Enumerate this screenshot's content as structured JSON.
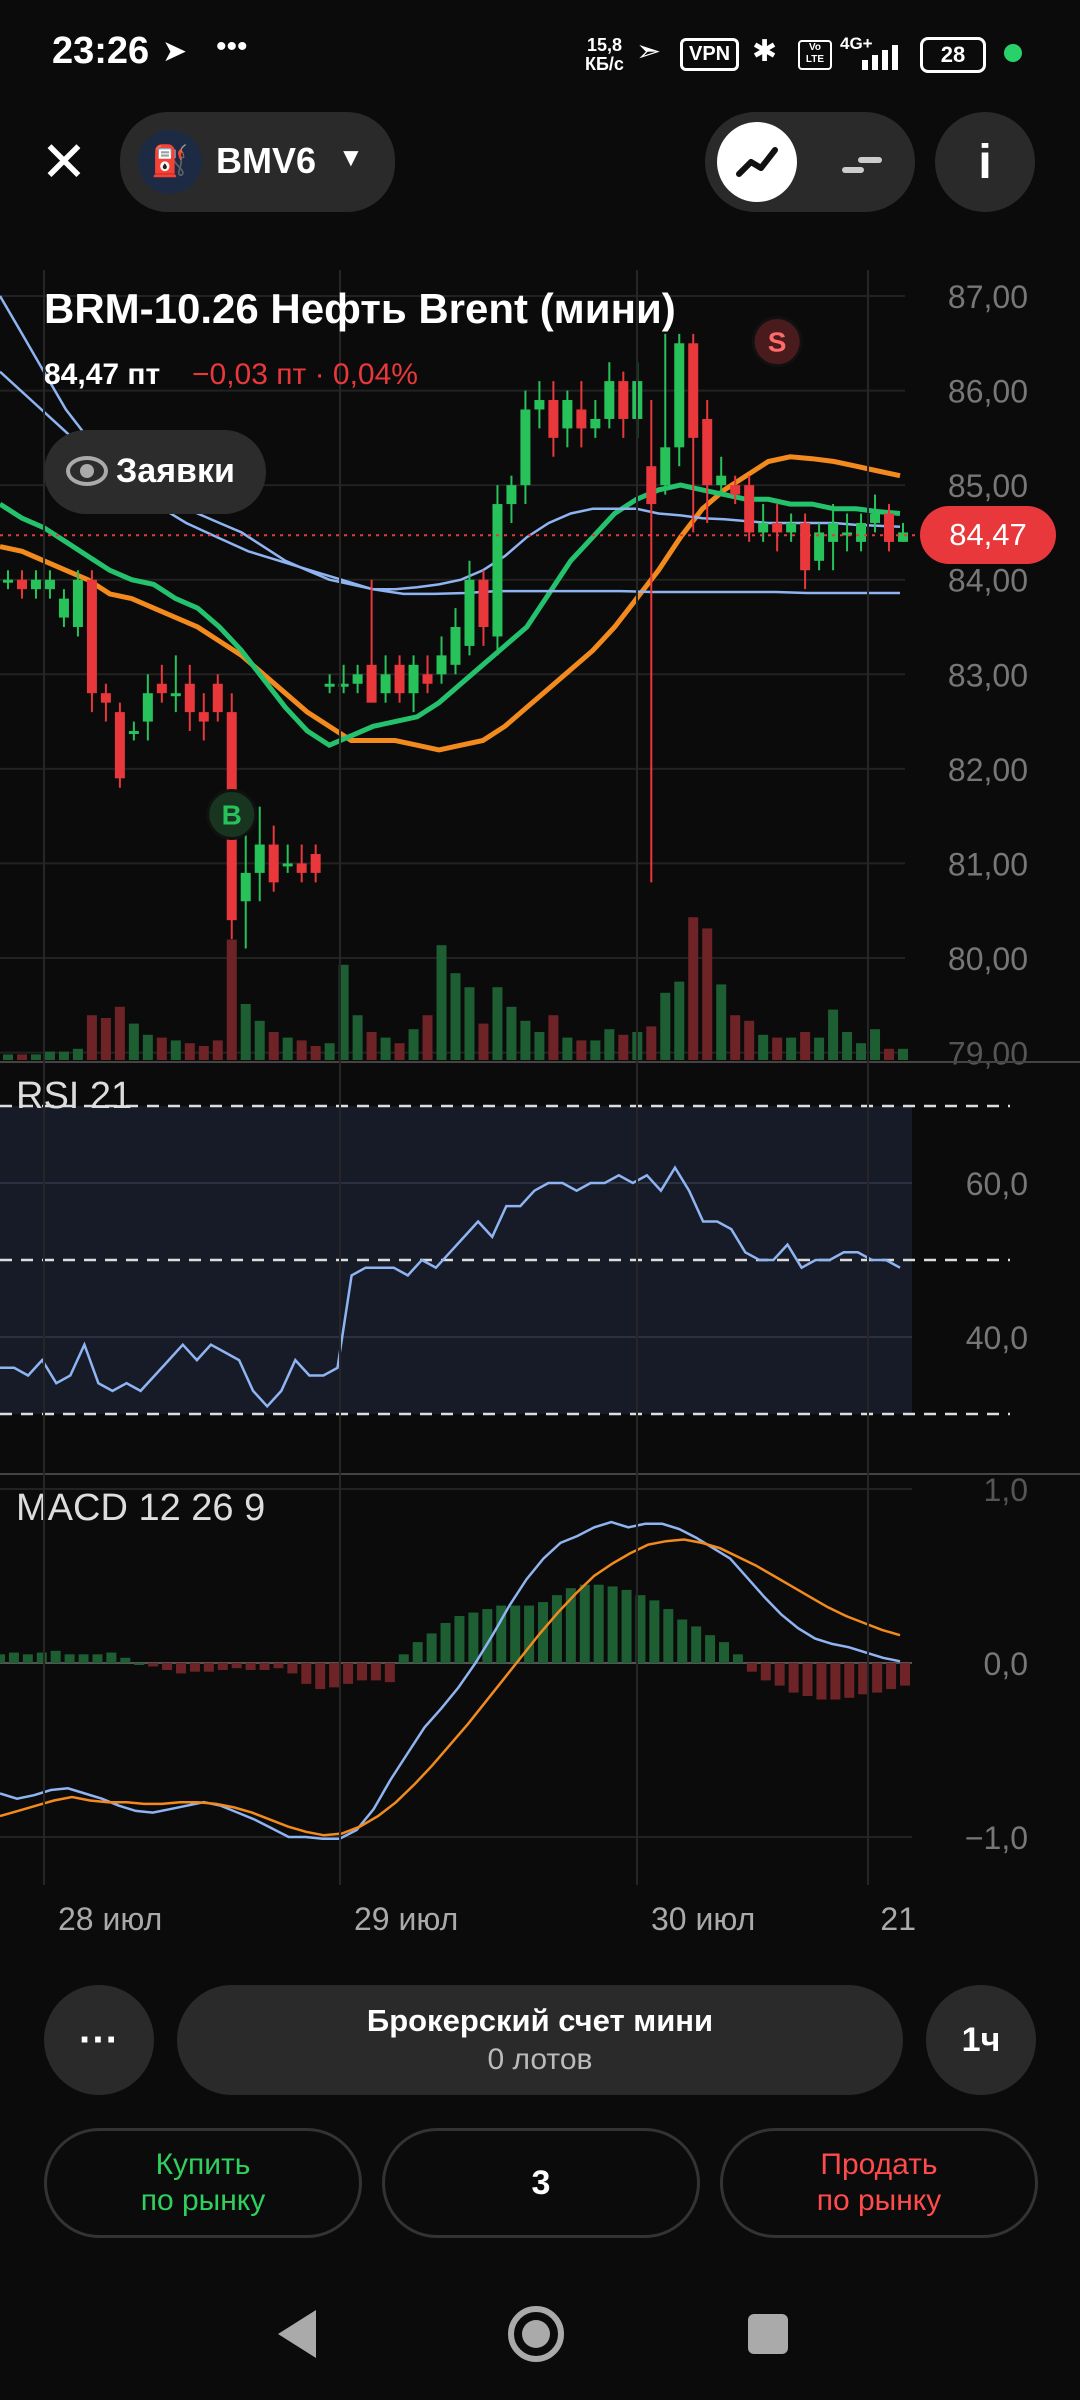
{
  "status_bar": {
    "time": "23:26",
    "net_speed_value": "15,8",
    "net_speed_unit": "КБ/с",
    "vpn": "VPN",
    "network": "4G+",
    "battery": "28",
    "icons": [
      "telegram-icon",
      "more-icon",
      "location-icon",
      "bluetooth-icon",
      "volte-icon",
      "signal-icon"
    ]
  },
  "header": {
    "ticker": "BMV6",
    "instrument_title": "BRM-10.26 Нефть Brent (мини)",
    "price": "84,47 пт",
    "change": "−0,03 пт · 0,04%",
    "orders_label": "Заявки",
    "current_price_tag": "84,47"
  },
  "colors": {
    "up": "#27c25a",
    "down": "#e8383b",
    "ma_orange": "#f28a1e",
    "ma_green": "#25c26e",
    "ma_blue": "#8fb4f2",
    "accent_red_tag": "#e8383b"
  },
  "chart_data": [
    {
      "type": "candlestick",
      "title": "",
      "y_ticks": [
        "87,00",
        "86,00",
        "85,00",
        "84,00",
        "83,00",
        "82,00",
        "81,00",
        "80,00",
        "79,00"
      ],
      "ylim": [
        79,
        87.6
      ],
      "x_ticks": [
        "28 июл",
        "29 июл",
        "30 июл",
        "21"
      ],
      "last_price": 84.47,
      "markers": [
        {
          "label": "B",
          "x": 16,
          "price": 81.2
        },
        {
          "label": "S",
          "x": 55,
          "price": 86.2
        }
      ],
      "candles": [
        [
          84.0,
          84.0,
          83.9,
          84.1
        ],
        [
          84.0,
          83.9,
          83.8,
          84.1
        ],
        [
          83.9,
          84.0,
          83.8,
          84.1
        ],
        [
          83.9,
          84.0,
          83.8,
          84.1
        ],
        [
          83.6,
          83.8,
          83.5,
          83.9
        ],
        [
          83.5,
          84.0,
          83.4,
          84.1
        ],
        [
          84.0,
          82.8,
          82.6,
          84.1
        ],
        [
          82.8,
          82.7,
          82.5,
          82.9
        ],
        [
          82.6,
          81.9,
          81.8,
          82.7
        ],
        [
          82.4,
          82.4,
          82.3,
          82.5
        ],
        [
          82.5,
          82.8,
          82.3,
          83.0
        ],
        [
          82.9,
          82.8,
          82.7,
          83.1
        ],
        [
          82.8,
          82.8,
          82.6,
          83.2
        ],
        [
          82.9,
          82.6,
          82.4,
          83.1
        ],
        [
          82.6,
          82.5,
          82.3,
          82.8
        ],
        [
          82.9,
          82.6,
          82.5,
          83.0
        ],
        [
          82.6,
          80.4,
          80.2,
          82.8
        ],
        [
          80.6,
          80.9,
          80.1,
          81.3
        ],
        [
          80.9,
          81.2,
          80.6,
          81.6
        ],
        [
          81.2,
          80.8,
          80.7,
          81.4
        ],
        [
          81.0,
          81.0,
          80.9,
          81.2
        ],
        [
          81.0,
          80.9,
          80.8,
          81.2
        ],
        [
          81.1,
          80.9,
          80.8,
          81.2
        ],
        [
          82.9,
          82.9,
          82.8,
          83.0
        ],
        [
          82.9,
          82.9,
          82.8,
          83.1
        ],
        [
          82.9,
          83.0,
          82.8,
          83.1
        ],
        [
          83.1,
          82.7,
          82.7,
          84.0
        ],
        [
          82.8,
          83.0,
          82.7,
          83.2
        ],
        [
          83.1,
          82.8,
          82.7,
          83.2
        ],
        [
          82.8,
          83.1,
          82.6,
          83.2
        ],
        [
          83.0,
          82.9,
          82.8,
          83.2
        ],
        [
          83.0,
          83.2,
          82.9,
          83.4
        ],
        [
          83.1,
          83.5,
          83.0,
          83.7
        ],
        [
          83.3,
          84.0,
          83.2,
          84.2
        ],
        [
          84.0,
          83.5,
          83.3,
          84.1
        ],
        [
          83.4,
          84.8,
          83.2,
          85.0
        ],
        [
          84.8,
          85.0,
          84.6,
          85.1
        ],
        [
          85.0,
          85.8,
          84.8,
          86.0
        ],
        [
          85.8,
          85.9,
          85.6,
          86.1
        ],
        [
          85.9,
          85.5,
          85.3,
          86.1
        ],
        [
          85.6,
          85.9,
          85.4,
          86.0
        ],
        [
          85.8,
          85.6,
          85.4,
          86.1
        ],
        [
          85.6,
          85.7,
          85.5,
          85.9
        ],
        [
          85.7,
          86.1,
          85.6,
          86.3
        ],
        [
          86.1,
          85.7,
          85.5,
          86.2
        ],
        [
          85.7,
          86.1,
          85.5,
          86.3
        ],
        [
          85.2,
          84.8,
          80.8,
          85.9
        ],
        [
          85.0,
          85.4,
          84.9,
          86.6
        ],
        [
          85.4,
          86.5,
          85.2,
          86.6
        ],
        [
          86.5,
          85.5,
          84.5,
          86.6
        ],
        [
          85.7,
          85.0,
          84.6,
          85.9
        ],
        [
          85.0,
          85.1,
          84.9,
          85.3
        ],
        [
          85.0,
          84.9,
          84.8,
          85.1
        ],
        [
          85.0,
          84.5,
          84.4,
          85.1
        ],
        [
          84.5,
          84.6,
          84.4,
          84.8
        ],
        [
          84.6,
          84.5,
          84.3,
          84.8
        ],
        [
          84.5,
          84.6,
          84.4,
          84.7
        ],
        [
          84.6,
          84.1,
          83.9,
          84.7
        ],
        [
          84.2,
          84.5,
          84.1,
          84.6
        ],
        [
          84.4,
          84.6,
          84.1,
          84.8
        ],
        [
          84.5,
          84.5,
          84.3,
          84.7
        ],
        [
          84.4,
          84.6,
          84.3,
          84.7
        ],
        [
          84.6,
          84.7,
          84.5,
          84.9
        ],
        [
          84.7,
          84.4,
          84.3,
          84.8
        ],
        [
          84.4,
          84.5,
          84.4,
          84.6
        ]
      ],
      "volumes": [
        0.2,
        0.2,
        0.2,
        0.3,
        0.3,
        0.4,
        1.6,
        1.5,
        1.9,
        1.3,
        0.9,
        0.8,
        0.7,
        0.6,
        0.5,
        0.7,
        4.3,
        2.0,
        1.4,
        1.0,
        0.8,
        0.7,
        0.5,
        0.6,
        3.4,
        1.6,
        1.0,
        0.8,
        0.6,
        1.1,
        1.6,
        4.1,
        3.1,
        2.6,
        1.3,
        2.6,
        1.9,
        1.4,
        1.0,
        1.6,
        0.8,
        0.7,
        0.7,
        1.1,
        0.9,
        1.0,
        1.2,
        2.4,
        2.8,
        5.1,
        4.7,
        2.7,
        1.6,
        1.4,
        0.9,
        0.8,
        0.8,
        1.0,
        0.8,
        1.8,
        1.0,
        0.6,
        1.1,
        0.4,
        0.4
      ],
      "series": [
        {
          "values": [
            84.35,
            84.3,
            84.2,
            84.1,
            84.0,
            83.85,
            83.8,
            83.7,
            83.6,
            83.5,
            83.35,
            83.2,
            83.0,
            82.8,
            82.6,
            82.45,
            82.3,
            82.3,
            82.3,
            82.25,
            82.2,
            82.25,
            82.3,
            82.45,
            82.65,
            82.85,
            83.05,
            83.25,
            83.5,
            83.8,
            84.1,
            84.45,
            84.75,
            84.95,
            85.1,
            85.25,
            85.3,
            85.28,
            85.25,
            85.2,
            85.15,
            85.1
          ]
        },
        {
          "values": [
            84.8,
            84.65,
            84.55,
            84.4,
            84.25,
            84.1,
            84.0,
            83.95,
            83.8,
            83.7,
            83.5,
            83.25,
            82.95,
            82.65,
            82.4,
            82.25,
            82.35,
            82.45,
            82.5,
            82.55,
            82.7,
            82.9,
            83.1,
            83.3,
            83.5,
            83.85,
            84.2,
            84.45,
            84.7,
            84.85,
            84.95,
            85.0,
            84.95,
            84.9,
            84.85,
            84.85,
            84.8,
            84.8,
            84.75,
            84.75,
            84.72,
            84.7
          ]
        },
        {
          "values": [
            87.0,
            86.6,
            86.2,
            85.8,
            85.5,
            85.3,
            85.1,
            84.95,
            84.8,
            84.7,
            84.6,
            84.5,
            84.35,
            84.2,
            84.1,
            84.0,
            83.95,
            83.9,
            83.9,
            83.92,
            83.95,
            84.0,
            84.1,
            84.25,
            84.45,
            84.6,
            84.7,
            84.75,
            84.75,
            84.75,
            84.7,
            84.68,
            84.65,
            84.64,
            84.62,
            84.6,
            84.6,
            84.6,
            84.6,
            84.58,
            84.57,
            84.56
          ]
        },
        {
          "values": [
            86.2,
            85.9,
            85.6,
            85.3,
            85.0,
            84.8,
            84.6,
            84.45,
            84.3,
            84.2,
            84.1,
            84.0,
            83.9,
            83.85,
            83.85,
            83.86,
            83.88,
            83.88,
            83.88,
            83.88,
            83.88,
            83.87,
            83.87,
            83.87,
            83.87,
            83.87,
            83.86,
            83.86,
            83.86,
            83.86
          ]
        }
      ]
    },
    {
      "type": "line",
      "title": "RSI 21",
      "y_ticks": [
        "60,0",
        "40,0"
      ],
      "ylim": [
        25,
        75
      ],
      "band": [
        30,
        70
      ],
      "midline": 50,
      "values": [
        36,
        36,
        35,
        37,
        34,
        35,
        39,
        34,
        33,
        34,
        33,
        35,
        37,
        39,
        37,
        39,
        38,
        37,
        33,
        31,
        33,
        37,
        35,
        35,
        36,
        48,
        49,
        49,
        49,
        48,
        50,
        49,
        51,
        53,
        55,
        53,
        57,
        57,
        59,
        60,
        60,
        59,
        60,
        60,
        61,
        60,
        61,
        59,
        62,
        59,
        55,
        55,
        54,
        51,
        50,
        50,
        52,
        49,
        50,
        50,
        51,
        51,
        50,
        50,
        49
      ]
    },
    {
      "type": "line",
      "title": "MACD 12 26 9",
      "y_ticks": [
        "1,0",
        "0,0",
        "−1,0"
      ],
      "ylim": [
        -1.25,
        1.05
      ],
      "macd": [
        -0.75,
        -0.78,
        -0.76,
        -0.73,
        -0.72,
        -0.75,
        -0.78,
        -0.82,
        -0.85,
        -0.86,
        -0.84,
        -0.82,
        -0.8,
        -0.82,
        -0.86,
        -0.9,
        -0.95,
        -1.0,
        -1.0,
        -1.01,
        -1.01,
        -0.96,
        -0.84,
        -0.67,
        -0.52,
        -0.37,
        -0.26,
        -0.14,
        0.0,
        0.16,
        0.33,
        0.48,
        0.6,
        0.69,
        0.73,
        0.78,
        0.81,
        0.78,
        0.8,
        0.8,
        0.77,
        0.72,
        0.66,
        0.6,
        0.49,
        0.38,
        0.28,
        0.2,
        0.14,
        0.11,
        0.09,
        0.06,
        0.03,
        0.01
      ],
      "signal": [
        -0.88,
        -0.85,
        -0.82,
        -0.79,
        -0.77,
        -0.79,
        -0.8,
        -0.8,
        -0.81,
        -0.81,
        -0.8,
        -0.8,
        -0.81,
        -0.83,
        -0.86,
        -0.9,
        -0.94,
        -0.97,
        -0.99,
        -0.98,
        -0.94,
        -0.88,
        -0.8,
        -0.7,
        -0.59,
        -0.47,
        -0.35,
        -0.22,
        -0.09,
        0.04,
        0.17,
        0.29,
        0.4,
        0.5,
        0.57,
        0.63,
        0.68,
        0.7,
        0.71,
        0.69,
        0.66,
        0.61,
        0.56,
        0.5,
        0.44,
        0.38,
        0.32,
        0.27,
        0.23,
        0.19,
        0.16
      ],
      "histogram": [
        0.05,
        0.06,
        0.05,
        0.06,
        0.07,
        0.05,
        0.05,
        0.05,
        0.06,
        0.03,
        0.0,
        -0.02,
        -0.04,
        -0.06,
        -0.05,
        -0.05,
        -0.04,
        -0.03,
        -0.04,
        -0.04,
        -0.03,
        -0.06,
        -0.12,
        -0.15,
        -0.14,
        -0.12,
        -0.1,
        -0.1,
        -0.11,
        0.05,
        0.12,
        0.17,
        0.23,
        0.27,
        0.29,
        0.31,
        0.33,
        0.33,
        0.33,
        0.35,
        0.39,
        0.43,
        0.45,
        0.45,
        0.44,
        0.42,
        0.39,
        0.36,
        0.31,
        0.25,
        0.21,
        0.16,
        0.12,
        0.05,
        -0.05,
        -0.1,
        -0.13,
        -0.17,
        -0.19,
        -0.21,
        -0.21,
        -0.2,
        -0.18,
        -0.17,
        -0.15,
        -0.13
      ]
    }
  ],
  "bottom": {
    "more_label": "···",
    "account_name": "Брокерский счет мини",
    "account_lots": "0 лотов",
    "timeframe": "1ч",
    "buy_line1": "Купить",
    "buy_line2": "по рынку",
    "quantity": "3",
    "sell_line1": "Продать",
    "sell_line2": "по рынку"
  }
}
